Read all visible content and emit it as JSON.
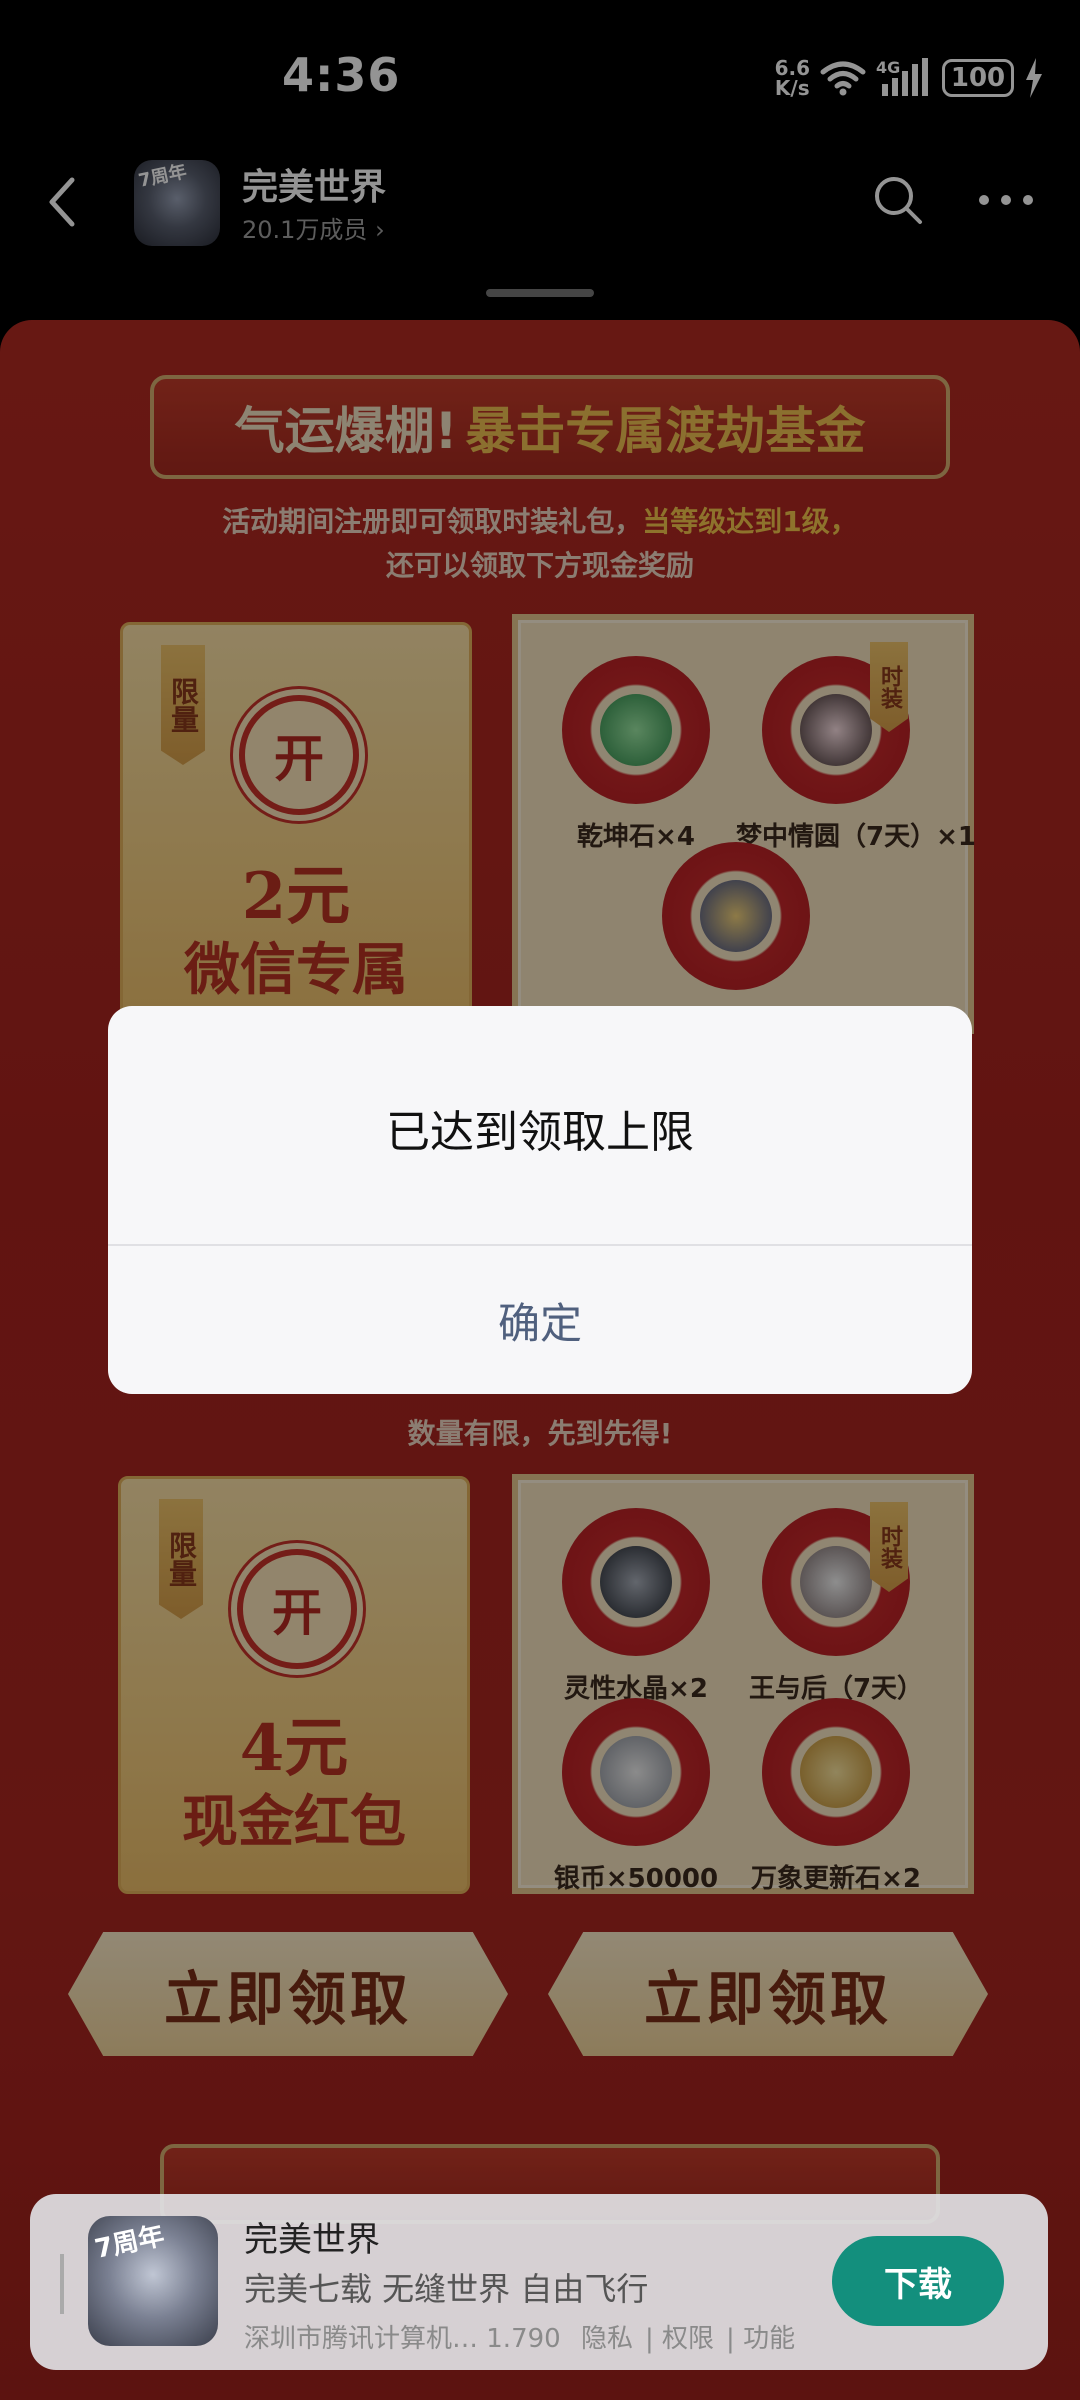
{
  "status_bar": {
    "time": "4:36",
    "net_speed_value": "6.6",
    "net_speed_unit": "K/s",
    "signal_label": "4G",
    "battery": "100"
  },
  "header": {
    "title": "完美世界",
    "members": "20.1万成员 ›",
    "avatar_badge": "7周年"
  },
  "poster": {
    "banner_left": "气运爆棚!",
    "banner_right": "暴击专属渡劫基金",
    "intro_line1_plain": "活动期间注册即可领取时装礼包，",
    "intro_line1_highlight": "当等级达到1级，",
    "intro_line2": "还可以领取下方现金奖励",
    "limit_tag": "限量",
    "open_label": "开",
    "fashion_tag": "时装",
    "envelope1_amount": "2元",
    "envelope1_desc": "微信专属",
    "rewards1": [
      "乾坤石×4",
      "梦中情圆（7天）×1"
    ],
    "section2_text": "数量有限，先到先得!",
    "envelope2_amount": "4元",
    "envelope2_desc": "现金红包",
    "rewards2": [
      "灵性水晶×2",
      "王与后（7天）",
      "银币×50000",
      "万象更新石×2"
    ],
    "claim_label": "立即领取"
  },
  "dialog": {
    "message": "已达到领取上限",
    "confirm": "确定"
  },
  "app_card": {
    "title": "完美世界",
    "subtitle": "完美七载 无缝世界 自由飞行",
    "developer": "深圳市腾讯计算机… 1.790",
    "privacy": "隐私",
    "permissions": "权限",
    "features": "功能",
    "download": "下载",
    "icon_badge": "7周年"
  },
  "colors": {
    "poster_red": "#b22a22",
    "gold": "#f5c64d",
    "download_green": "#138f7d",
    "confirm_blue": "#50607e"
  }
}
